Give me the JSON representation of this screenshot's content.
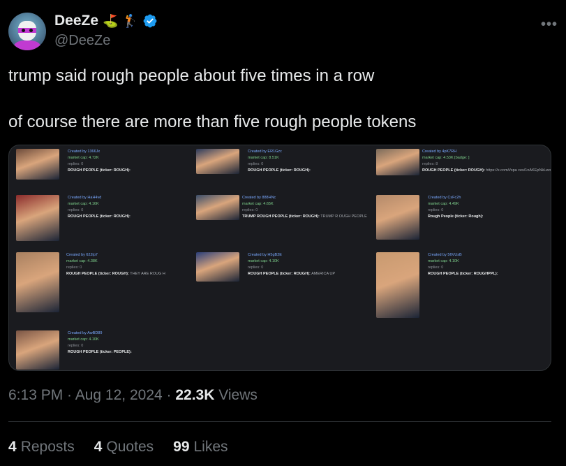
{
  "author": {
    "display_name": "DeeZe",
    "handle": "@DeeZe",
    "badges": [
      "⛳",
      "🏌️"
    ],
    "verified": true
  },
  "more_icon": "•••",
  "tweet": {
    "line1": "trump said rough people about five times in a row",
    "line2": "of course there are more than five rough people tokens"
  },
  "media": {
    "cards": [
      {
        "created_by": "Created by",
        "creator": "1366Jx",
        "market_cap": "market cap: 4.72K",
        "replies": "replies: 0",
        "title": "ROUGH PEOPLE (ticker: ROUGH):",
        "desc": ""
      },
      {
        "created_by": "Created by",
        "creator": "ER1Gzc",
        "market_cap": "market cap: 8.51K",
        "replies": "replies: 0",
        "title": "ROUGH PEOPLE (ticker: ROUGH):",
        "desc": ""
      },
      {
        "created_by": "Created by",
        "creator": "4pK7RH",
        "market_cap": "market cap: 4.53K [badge: ]",
        "replies": "replies: 8",
        "title": "ROUGH PEOPLE (ticker: ROUGH):",
        "desc": "https://x.com/i/spa ces/1nAKEpNkLwoxL"
      },
      {
        "created_by": "Created by",
        "creator": "HaH4vd",
        "market_cap": "market cap: 4.16K",
        "replies": "replies: 0",
        "title": "ROUGH PEOPLE (ticker: ROUGH):",
        "desc": ""
      },
      {
        "created_by": "Created by",
        "creator": "888HNc",
        "market_cap": "market cap: 4.65K",
        "replies": "replies: 0",
        "title": "TRUMP ROUGH PEOPLE (ticker: ROUGH):",
        "desc": "TRUMP R OUGH PEOPLE"
      },
      {
        "created_by": "Created by",
        "creator": "CsFc2h",
        "market_cap": "market cap: 4.49K",
        "replies": "replies: 0",
        "title": "Rough People (ticker: Rough):",
        "desc": ""
      },
      {
        "created_by": "Created by",
        "creator": "62JIp7",
        "market_cap": "market cap: 4.38K",
        "replies": "replies: 0",
        "title": "ROUGH PEOPLE (ticker: ROUGH):",
        "desc": "THEY ARE ROUG H"
      },
      {
        "created_by": "Created by",
        "creator": "H5gB2E",
        "market_cap": "market cap: 4.10K",
        "replies": "replies: 0",
        "title": "ROUGH PEOPLE (ticker: ROUGH):",
        "desc": "AMERICA UP"
      },
      {
        "created_by": "Created by",
        "creator": "56VUsB",
        "market_cap": "market cap: 4.10K",
        "replies": "replies: 0",
        "title": "ROUGH PEOPLE (ticker: ROUGHPPL):",
        "desc": ""
      },
      {
        "created_by": "Created by",
        "creator": "AwBD89",
        "market_cap": "market cap: 4.10K",
        "replies": "replies: 0",
        "title": "ROUGH PEOPLE (ticker: PEOPLE):",
        "desc": ""
      }
    ]
  },
  "footer": {
    "time": "6:13 PM",
    "sep1": " · ",
    "date": "Aug 12, 2024",
    "sep2": " · ",
    "views_count": "22.3K",
    "views_label": " Views"
  },
  "stats": {
    "reposts_count": "4",
    "reposts_label": "Reposts",
    "quotes_count": "4",
    "quotes_label": "Quotes",
    "likes_count": "99",
    "likes_label": "Likes"
  },
  "colors": {
    "background": "#000000",
    "text": "#e7e9ea",
    "muted": "#71767b",
    "verified": "#1d9bf0",
    "border": "#2f3336"
  }
}
